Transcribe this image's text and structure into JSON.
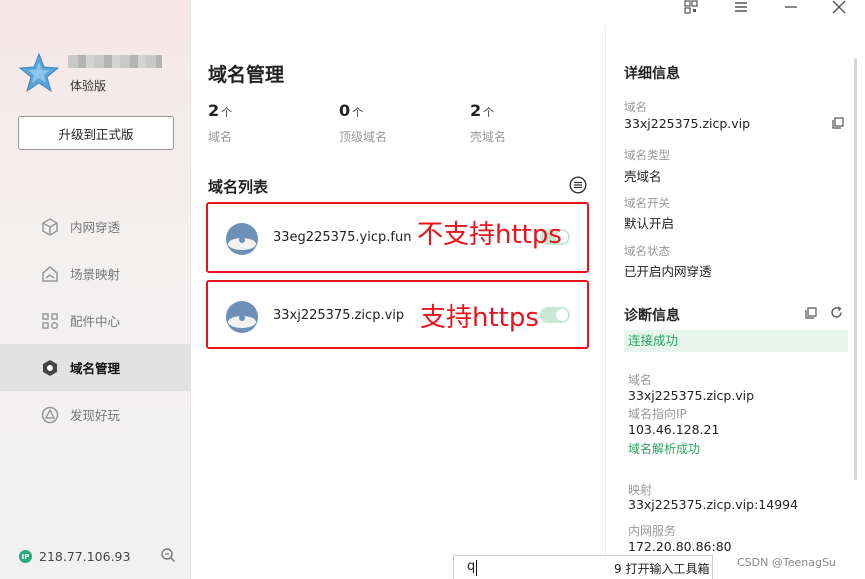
{
  "app": {
    "edition": "体验版",
    "upgrade_label": "升级到正式版"
  },
  "nav": {
    "items": [
      {
        "label": "内网穿透",
        "icon": "cube-icon"
      },
      {
        "label": "场景映射",
        "icon": "scene-map-icon"
      },
      {
        "label": "配件中心",
        "icon": "apps-grid-icon"
      },
      {
        "label": "域名管理",
        "icon": "domain-manage-icon"
      },
      {
        "label": "发现好玩",
        "icon": "discover-icon"
      }
    ],
    "active": "域名管理"
  },
  "footer": {
    "ip_badge": "IP",
    "ip": "218.77.106.93"
  },
  "main": {
    "title": "域名管理",
    "stats": [
      {
        "num": "2",
        "unit": "个",
        "label": "域名"
      },
      {
        "num": "0",
        "unit": "个",
        "label": "顶级域名"
      },
      {
        "num": "2",
        "unit": "个",
        "label": "壳域名"
      }
    ],
    "list_title": "域名列表",
    "domains": [
      {
        "name": "33eg225375.yicp.fun",
        "enabled": true
      },
      {
        "name": "33xj225375.zicp.vip",
        "enabled": true
      }
    ],
    "annotations": [
      "不支持https",
      "支持https"
    ]
  },
  "detail": {
    "title": "详细信息",
    "fields": [
      {
        "label": "域名",
        "value": "33xj225375.zicp.vip"
      },
      {
        "label": "域名类型",
        "value": "壳域名"
      },
      {
        "label": "域名开关",
        "value": "默认开启"
      },
      {
        "label": "域名状态",
        "value": "已开启内网穿透"
      }
    ],
    "diag_title": "诊断信息",
    "diag_status": "连接成功",
    "diag_domain_label": "域名",
    "diag_domain": "33xj225375.zicp.vip",
    "diag_ip_label": "域名指向IP",
    "diag_ip": "103.46.128.21",
    "diag_resolve": "域名解析成功",
    "map_label": "映射",
    "map_value": "33xj225375.zicp.vip:14994",
    "lan_label": "内网服务",
    "lan_value": "172.20.80.86:80"
  },
  "ime": {
    "input": "q",
    "candidate": "9 打开输入工具箱"
  },
  "watermark": "CSDN @TeenagSu",
  "colors": {
    "accent_green": "#2aa35e",
    "annotation_red": "#e8141b"
  }
}
